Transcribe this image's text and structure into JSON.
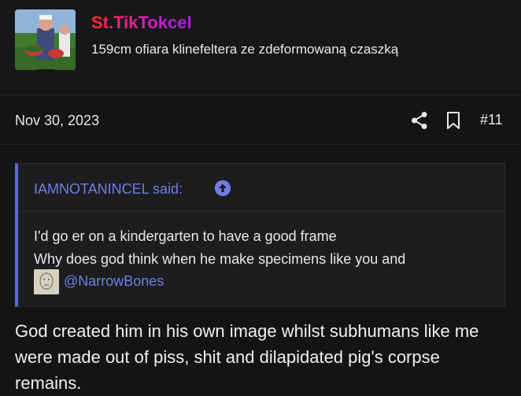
{
  "user": {
    "name": "St.TikTokcel",
    "title": "159cm ofiara klinefeltera ze zdeformowaną czaszką"
  },
  "post": {
    "date": "Nov 30, 2023",
    "number": "#11"
  },
  "quote": {
    "author": "IAMNOTANINCEL said:",
    "lines": [
      "I'd go er on a kindergarten to have a good frame",
      "Why does god think when he make specimens like you and"
    ],
    "mention": "@NarrowBones"
  },
  "body": "God created him in his own image whilst subhumans like me were made out of piss, shit and dilapidated pig's corpse remains.",
  "colors": {
    "accent": "#6f7fe0",
    "quote_border": "#5b6bcf",
    "background": "#141416"
  },
  "icons": [
    "share-icon",
    "bookmark-icon",
    "arrow-up-circle-icon"
  ]
}
